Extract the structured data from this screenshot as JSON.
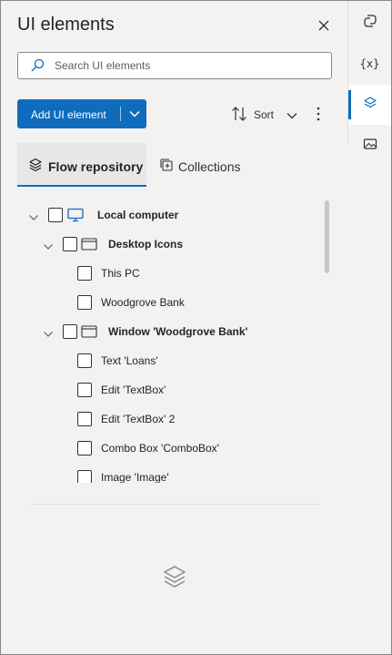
{
  "panel": {
    "title": "UI elements",
    "search_placeholder": "Search UI elements",
    "add_button_label": "Add UI element",
    "sort_label": "Sort"
  },
  "tabs": [
    {
      "label": "Flow repository",
      "active": true
    },
    {
      "label": "Collections",
      "active": false
    }
  ],
  "tree": {
    "root": "Local computer",
    "group1": "Desktop Icons",
    "g1_items": [
      "This PC",
      "Woodgrove Bank"
    ],
    "group2": "Window 'Woodgrove Bank'",
    "g2_items": [
      "Text 'Loans'",
      "Edit 'TextBox'",
      "Edit 'TextBox' 2",
      "Combo Box 'ComboBox'",
      "Image 'Image'"
    ]
  },
  "rail": {
    "items": [
      "copilot-icon",
      "variables-icon",
      "ui-elements-icon",
      "images-icon"
    ],
    "variables_glyph": "{x}"
  },
  "colors": {
    "accent": "#0f6cbd",
    "background": "#f3f2f1"
  }
}
